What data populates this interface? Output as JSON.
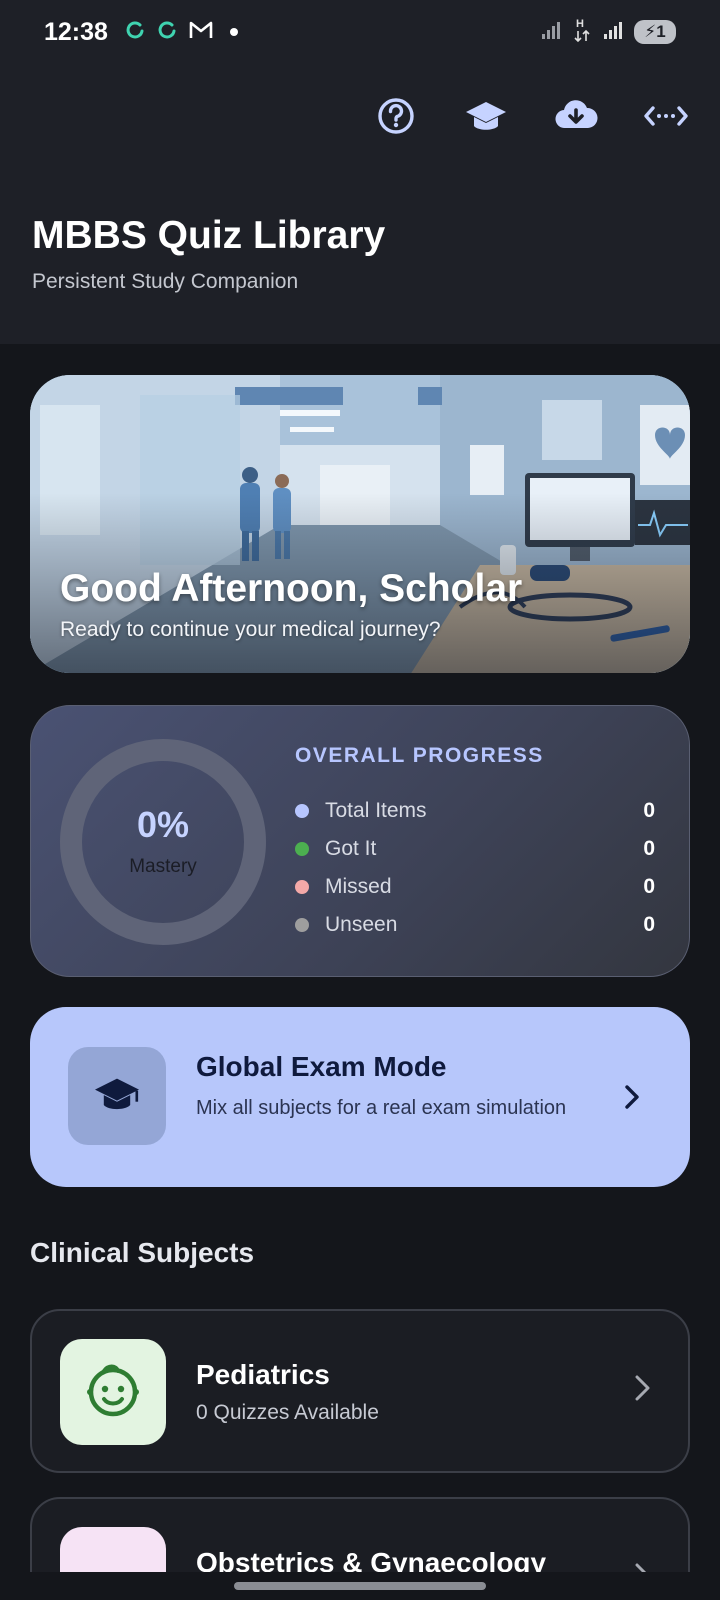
{
  "status_bar": {
    "time": "12:38",
    "battery_level": "1",
    "icons": [
      "sync-icon",
      "sync-icon",
      "gmail-icon",
      "notification-dot",
      "signal-icon",
      "data-activity-icon",
      "signal-icon",
      "battery-icon"
    ]
  },
  "header": {
    "title": "MBBS Quiz Library",
    "subtitle": "Persistent Study Companion",
    "toolbar_icons": [
      "help-icon",
      "graduation-cap-icon",
      "cloud-download-icon",
      "code-arrows-icon"
    ]
  },
  "hero": {
    "greeting": "Good Afternoon, Scholar",
    "subtitle": "Ready to continue your medical journey?"
  },
  "progress": {
    "title": "OVERALL PROGRESS",
    "mastery_percent": "0%",
    "mastery_fraction": 0,
    "mastery_label": "Mastery",
    "stats": [
      {
        "label": "Total Items",
        "value": "0",
        "color": "#b7c6ff"
      },
      {
        "label": "Got It",
        "value": "0",
        "color": "#4caf50"
      },
      {
        "label": "Missed",
        "value": "0",
        "color": "#f4a9a8"
      },
      {
        "label": "Unseen",
        "value": "0",
        "color": "#9e9e9e"
      }
    ]
  },
  "exam_mode": {
    "title": "Global Exam Mode",
    "description": "Mix all subjects for a real exam simulation",
    "icon": "graduation-cap-icon"
  },
  "clinical_subjects": {
    "section_title": "Clinical Subjects",
    "items": [
      {
        "name": "Pediatrics",
        "count": "0 Quizzes Available",
        "icon": "baby-face-icon",
        "icon_bg": "#e3f4e1",
        "icon_color": "#2e7d32"
      },
      {
        "name": "Obstetrics & Gynaecology",
        "count": "",
        "icon": "person-icon",
        "icon_bg": "#f6e3f5",
        "icon_color": "#7b1f8a"
      }
    ]
  }
}
